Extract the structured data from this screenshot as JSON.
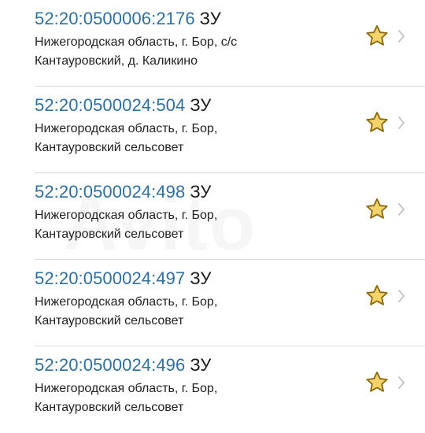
{
  "items": [
    {
      "number": "52:20:0500006:2176",
      "kind": "ЗУ",
      "address_line1": "Нижегородская область, г. Бор, с/с",
      "address_line2": "Кантауровский, д. Каликино"
    },
    {
      "number": "52:20:0500024:504",
      "kind": "ЗУ",
      "address_line1": "Нижегородская область, г. Бор,",
      "address_line2": "Кантауровский сельсовет"
    },
    {
      "number": "52:20:0500024:498",
      "kind": "ЗУ",
      "address_line1": "Нижегородская область, г. Бор,",
      "address_line2": "Кантауровский сельсовет"
    },
    {
      "number": "52:20:0500024:497",
      "kind": "ЗУ",
      "address_line1": "Нижегородская область, г. Бор,",
      "address_line2": "Кантауровский сельсовет"
    },
    {
      "number": "52:20:0500024:496",
      "kind": "ЗУ",
      "address_line1": "Нижегородская область, г. Бор,",
      "address_line2": "Кантауровский сельсовет"
    }
  ],
  "watermark": "Avito",
  "colors": {
    "number": "#2f6f9f",
    "star_fill": "#f4d46a",
    "star_stroke": "#8a6a10",
    "chevron": "#c7c7cc",
    "separator": "#d9d9dc"
  },
  "icons": {
    "star": "star-icon",
    "chevron": "chevron-right-icon"
  }
}
